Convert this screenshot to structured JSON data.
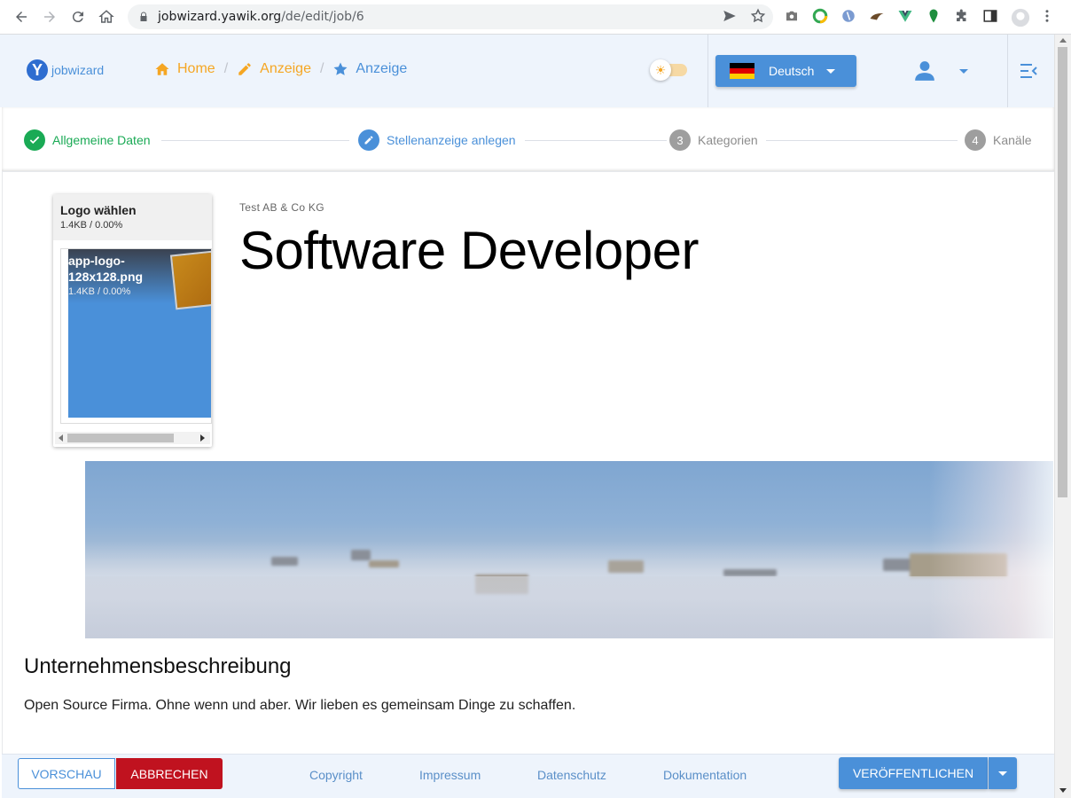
{
  "browser": {
    "url_host": "jobwizard.yawik.org",
    "url_path": "/de/edit/job/6"
  },
  "header": {
    "brand": "jobwizard",
    "breadcrumbs": [
      {
        "label": "Home",
        "color": "#f5a623"
      },
      {
        "label": "Anzeige",
        "color": "#f5a623"
      },
      {
        "label": "Anzeige",
        "color": "#4a90d9"
      }
    ],
    "language": "Deutsch"
  },
  "stepper": {
    "steps": [
      {
        "label": "Allgemeine Daten",
        "state": "done",
        "color": "#1aaa55"
      },
      {
        "label": "Stellenanzeige anlegen",
        "state": "active",
        "color": "#4a90d9"
      },
      {
        "number": "3",
        "label": "Kategorien",
        "state": "pending",
        "color": "#9e9e9e"
      },
      {
        "number": "4",
        "label": "Kanäle",
        "state": "pending",
        "color": "#9e9e9e"
      }
    ]
  },
  "logo_upload": {
    "title": "Logo wählen",
    "size": "1.4KB / 0.00%",
    "file_name": "app-logo-128x128.png",
    "file_size": "1.4KB / 0.00%"
  },
  "job": {
    "company": "Test AB & Co KG",
    "title": "Software Developer",
    "description_heading": "Unternehmensbeschreibung",
    "description_text": "Open Source Firma. Ohne wenn und aber. Wir lieben es gemeinsam Dinge zu schaffen."
  },
  "footer": {
    "preview": "VORSCHAU",
    "cancel": "ABBRECHEN",
    "links": [
      "Copyright",
      "Impressum",
      "Datenschutz",
      "Dokumentation"
    ],
    "publish": "VERÖFFENTLICHEN"
  }
}
